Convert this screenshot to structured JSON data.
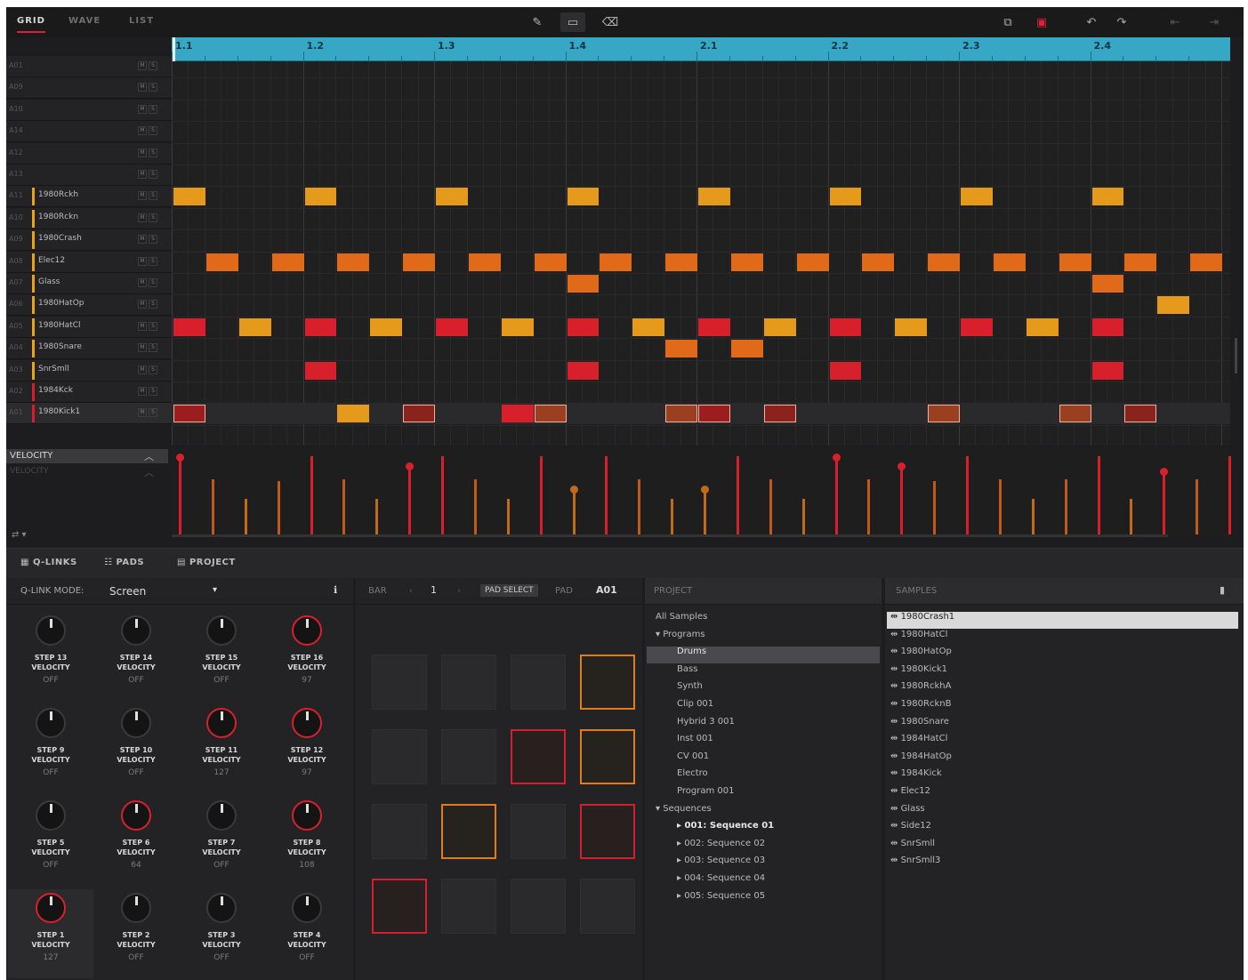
{
  "header": {
    "tabs": [
      {
        "label": "GRID",
        "active": true
      },
      {
        "label": "WAVE",
        "active": false
      },
      {
        "label": "LIST",
        "active": false
      }
    ]
  },
  "ruler": {
    "marks": [
      "1.1",
      "1.2",
      "1.3",
      "1.4",
      "2.1",
      "2.2",
      "2.3",
      "2.4"
    ]
  },
  "lanes": [
    {
      "pad": "A01",
      "name": ""
    },
    {
      "pad": "A09",
      "name": ""
    },
    {
      "pad": "A10",
      "name": ""
    },
    {
      "pad": "A14",
      "name": ""
    },
    {
      "pad": "A12",
      "name": ""
    },
    {
      "pad": "A13",
      "name": ""
    },
    {
      "pad": "A11",
      "name": "1980Rckh",
      "color": "#e8a317"
    },
    {
      "pad": "A10",
      "name": "1980Rckn",
      "color": "#e8a317"
    },
    {
      "pad": "A09",
      "name": "1980Crash",
      "color": "#e8a317"
    },
    {
      "pad": "A08",
      "name": "Elec12",
      "color": "#e8a317"
    },
    {
      "pad": "A07",
      "name": "Glass",
      "color": "#e8a317"
    },
    {
      "pad": "A06",
      "name": "1980HatOp",
      "color": "#e8a317"
    },
    {
      "pad": "A05",
      "name": "1980HatCl",
      "color": "#e8a317"
    },
    {
      "pad": "A04",
      "name": "1980Snare",
      "color": "#e8a317"
    },
    {
      "pad": "A03",
      "name": "SnrSmll",
      "color": "#e8a317"
    },
    {
      "pad": "A02",
      "name": "1984Kck",
      "color": "#d81e2a"
    },
    {
      "pad": "A01",
      "name": "1980Kick1",
      "color": "#d81e2a"
    }
  ],
  "velocity_label": "VELOCITY",
  "velocity_sublabel": "VELOCITY",
  "bottom_tabs": [
    {
      "label": "Q-LINKS"
    },
    {
      "label": "PADS"
    },
    {
      "label": "PROJECT"
    }
  ],
  "qlink": {
    "mode_label": "Q-LINK MODE:",
    "mode_value": "Screen",
    "knobs": [
      {
        "name": "STEP 13\nVELOCITY",
        "value": "OFF",
        "active": false
      },
      {
        "name": "STEP 14\nVELOCITY",
        "value": "OFF",
        "active": false
      },
      {
        "name": "STEP 15\nVELOCITY",
        "value": "OFF",
        "active": false
      },
      {
        "name": "STEP 16\nVELOCITY",
        "value": "97",
        "active": true
      },
      {
        "name": "STEP 9\nVELOCITY",
        "value": "OFF",
        "active": false
      },
      {
        "name": "STEP 10\nVELOCITY",
        "value": "OFF",
        "active": false
      },
      {
        "name": "STEP 11\nVELOCITY",
        "value": "127",
        "active": true
      },
      {
        "name": "STEP 12\nVELOCITY",
        "value": "97",
        "active": true
      },
      {
        "name": "STEP 5\nVELOCITY",
        "value": "OFF",
        "active": false
      },
      {
        "name": "STEP 6\nVELOCITY",
        "value": "64",
        "active": true
      },
      {
        "name": "STEP 7\nVELOCITY",
        "value": "OFF",
        "active": false
      },
      {
        "name": "STEP 8\nVELOCITY",
        "value": "108",
        "active": true
      },
      {
        "name": "STEP 1\nVELOCITY",
        "value": "127",
        "active": true
      },
      {
        "name": "STEP 2\nVELOCITY",
        "value": "OFF",
        "active": false
      },
      {
        "name": "STEP 3\nVELOCITY",
        "value": "OFF",
        "active": false
      },
      {
        "name": "STEP 4\nVELOCITY",
        "value": "OFF",
        "active": false
      }
    ]
  },
  "pads": {
    "bank_label": "BAR",
    "bank_value": "1",
    "pad_select_label": "PAD SELECT",
    "pad_label": "PAD",
    "pad_value": "A01",
    "grid": [
      "",
      "",
      "",
      "orange",
      "",
      "",
      "red",
      "orange",
      "",
      "orange",
      "",
      "red",
      "red",
      "",
      "",
      ""
    ]
  },
  "project": {
    "title": "PROJECT",
    "items": [
      {
        "text": "All Samples",
        "indent": 0
      },
      {
        "text": "▾ Programs",
        "indent": 0
      },
      {
        "text": "Drums",
        "indent": 2,
        "selected": true
      },
      {
        "text": "Bass",
        "indent": 2
      },
      {
        "text": "Synth",
        "indent": 2
      },
      {
        "text": "Clip 001",
        "indent": 2
      },
      {
        "text": "Hybrid 3 001",
        "indent": 2
      },
      {
        "text": "Inst 001",
        "indent": 2
      },
      {
        "text": "CV 001",
        "indent": 2
      },
      {
        "text": "Electro",
        "indent": 2
      },
      {
        "text": "Program 001",
        "indent": 2
      },
      {
        "text": "▾ Sequences",
        "indent": 0
      },
      {
        "text": "001: Sequence 01",
        "indent": 2,
        "bold": true
      },
      {
        "text": "002: Sequence 02",
        "indent": 2
      },
      {
        "text": "003: Sequence 03",
        "indent": 2
      },
      {
        "text": "004: Sequence 04",
        "indent": 2
      },
      {
        "text": "005: Sequence 05",
        "indent": 2
      }
    ]
  },
  "samples": {
    "title": "SAMPLES",
    "items": [
      "1980Crash1",
      "1980HatCl",
      "1980HatOp",
      "1980Kick1",
      "1980RckhA",
      "1980RcknB",
      "1980Snare",
      "1984HatCl",
      "1984HatOp",
      "1984Kick",
      "Elec12",
      "Glass",
      "Side12",
      "SnrSmll",
      "SnrSmll3"
    ]
  },
  "colors": {
    "accent": "#e0203a",
    "orange": "#e07b20",
    "amber": "#e8a317",
    "ruler": "#37a7c6"
  }
}
